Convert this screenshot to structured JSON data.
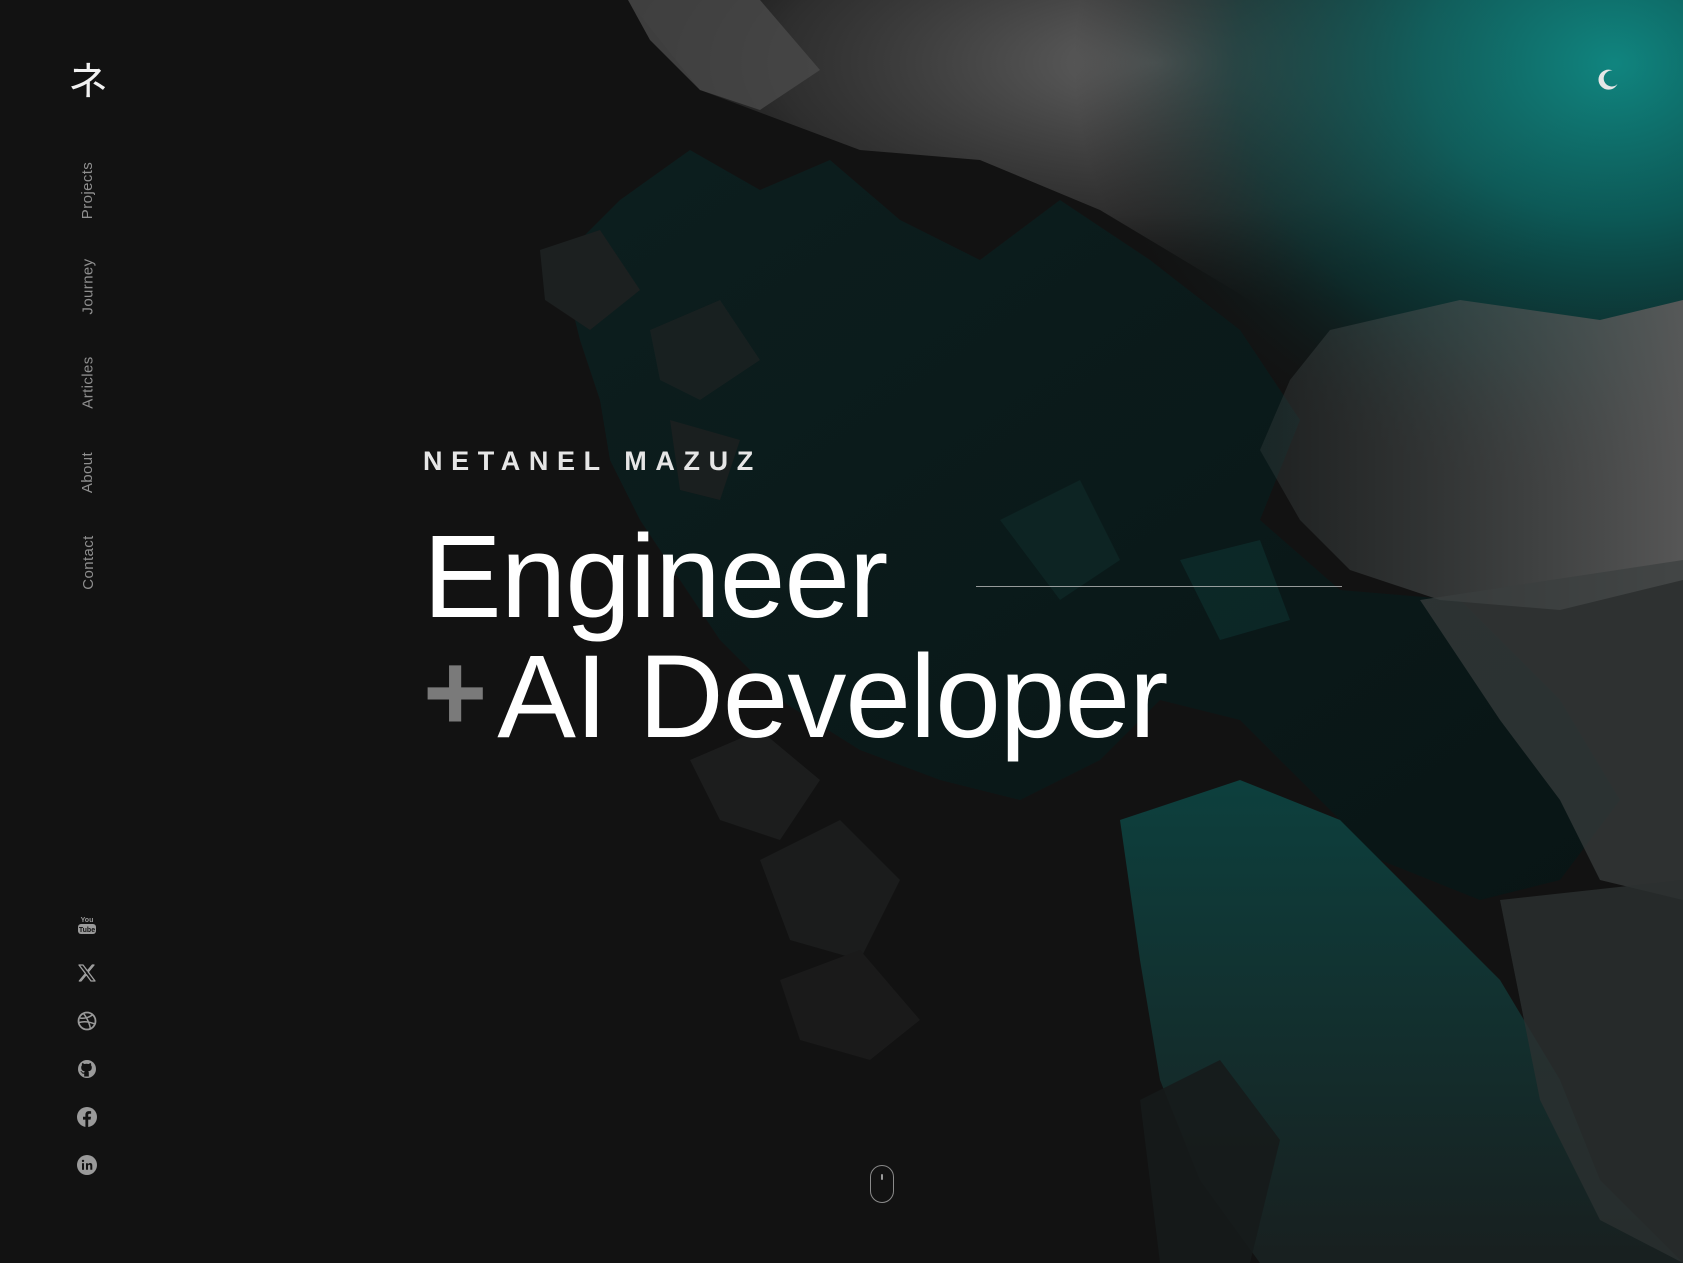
{
  "brand": {
    "logo_glyph": "ネ"
  },
  "nav": {
    "items": [
      {
        "label": "Projects"
      },
      {
        "label": "Journey"
      },
      {
        "label": "Articles"
      },
      {
        "label": "About"
      },
      {
        "label": "Contact"
      }
    ]
  },
  "theme_toggle": {
    "icon": "moon-icon"
  },
  "hero": {
    "name": "NETANEL MAZUZ",
    "line1": "Engineer",
    "plus": "+",
    "line2": "AI Developer"
  },
  "social": {
    "icons": [
      "youtube-icon",
      "x-icon",
      "dribbble-icon",
      "github-icon",
      "facebook-icon",
      "linkedin-icon"
    ]
  },
  "scroll_indicator": {
    "icon": "mouse-scroll-icon"
  },
  "colors": {
    "background": "#121212",
    "accent_teal": "#0c6f6c",
    "text_primary": "#ffffff",
    "text_muted": "#8f8f8f",
    "plus_gray": "#7a7a7a"
  }
}
